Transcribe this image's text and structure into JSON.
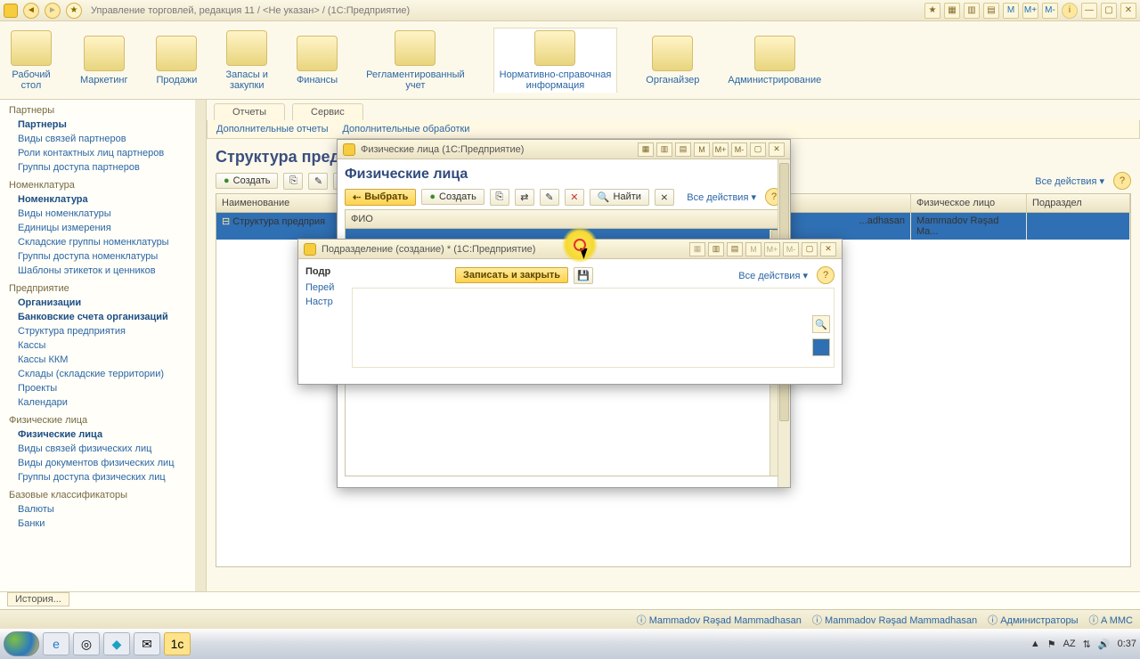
{
  "app": {
    "title": "Управление торговлей, редакция 11 / <Не указан> / (1С:Предприятие)",
    "m_labels": [
      "M",
      "M+",
      "M-"
    ]
  },
  "sections": [
    {
      "label": "Рабочий\nстол"
    },
    {
      "label": "Маркетинг"
    },
    {
      "label": "Продажи"
    },
    {
      "label": "Запасы и\nзакупки"
    },
    {
      "label": "Финансы"
    },
    {
      "label": "Регламентированный\nучет"
    },
    {
      "label": "Нормативно-справочная\nинформация"
    },
    {
      "label": "Органайзер"
    },
    {
      "label": "Администрирование"
    }
  ],
  "sidebar": [
    {
      "head": "Партнеры",
      "items": [
        {
          "t": "Партнеры",
          "b": 1
        },
        {
          "t": "Виды связей партнеров"
        },
        {
          "t": "Роли контактных лиц партнеров"
        },
        {
          "t": "Группы доступа партнеров"
        }
      ]
    },
    {
      "head": "Номенклатура",
      "items": [
        {
          "t": "Номенклатура",
          "b": 1
        },
        {
          "t": "Виды номенклатуры"
        },
        {
          "t": "Единицы измерения"
        },
        {
          "t": "Складские группы номенклатуры"
        },
        {
          "t": "Группы доступа номенклатуры"
        },
        {
          "t": "Шаблоны этикеток и ценников"
        }
      ]
    },
    {
      "head": "Предприятие",
      "items": [
        {
          "t": "Организации",
          "b": 1
        },
        {
          "t": "Банковские счета организаций",
          "b": 1
        },
        {
          "t": "Структура предприятия"
        },
        {
          "t": "Кассы"
        },
        {
          "t": "Кассы ККМ"
        },
        {
          "t": "Склады (складские территории)"
        },
        {
          "t": "Проекты"
        },
        {
          "t": "Календари"
        }
      ]
    },
    {
      "head": "Физические лица",
      "items": [
        {
          "t": "Физические лица",
          "b": 1
        },
        {
          "t": "Виды связей физических лиц"
        },
        {
          "t": "Виды документов физических лиц"
        },
        {
          "t": "Группы доступа физических лиц"
        }
      ]
    },
    {
      "head": "Базовые классификаторы",
      "items": [
        {
          "t": "Валюты"
        },
        {
          "t": "Банки"
        }
      ]
    }
  ],
  "panelTabs": {
    "a": "Отчеты",
    "b": "Сервис"
  },
  "panelSub": {
    "a": "Дополнительные отчеты",
    "b": "Дополнительные обработки"
  },
  "structure": {
    "title": "Структура предприятия",
    "create": "Создать",
    "all": "Все действия ▾",
    "cols": {
      "name": "Наименование",
      "manager": "Руководитель",
      "person": "Физическое лицо",
      "dept": "Подраздел"
    },
    "row": {
      "name": "Структура предприя",
      "manager": "...adhasan",
      "person": "Mammadov Rəşad Ma..."
    }
  },
  "persons": {
    "winTitle": "Физические лица  (1С:Предприятие)",
    "title": "Физические лица",
    "select": "Выбрать",
    "create": "Создать",
    "find": "Найти",
    "all": "Все действия ▾",
    "col": "ФИО"
  },
  "dept": {
    "winTitle": "Подразделение (создание) *   (1С:Предприятие)",
    "title": "Подразделение (создание) *",
    "tabs": {
      "a": "Перей",
      "b": "Настр"
    },
    "save": "Записать и закрыть",
    "all": "Все действия ▾"
  },
  "history": "История...",
  "status": {
    "u1": "Mammadov Rəşad Mammadhasan",
    "u2": "Mammadov Rəşad Mammadhasan",
    "admins": "Администраторы",
    "mmc": "A MMC"
  },
  "tray": {
    "lang": "AZ",
    "time": "0:37"
  }
}
